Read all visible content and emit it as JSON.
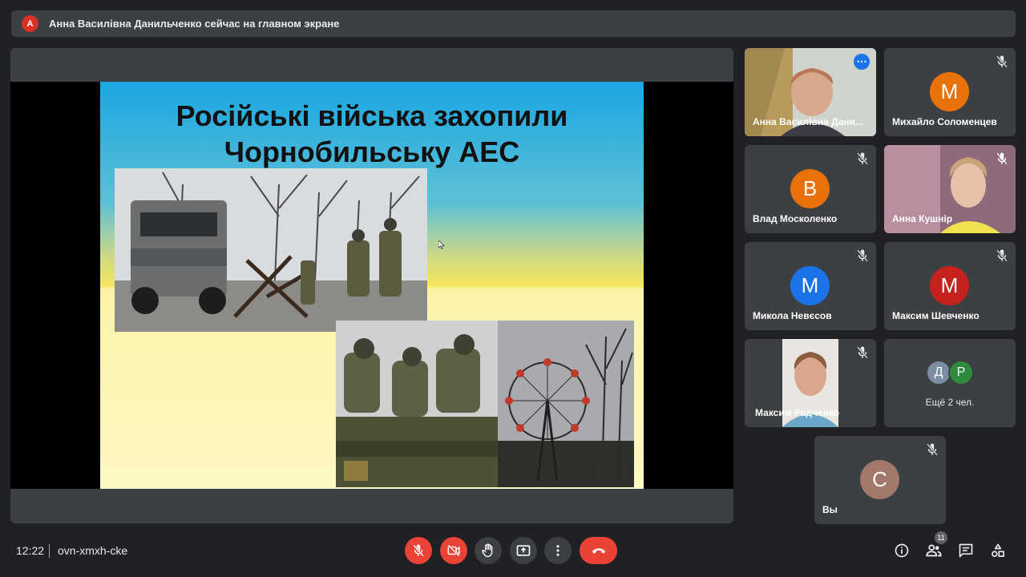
{
  "banner": {
    "avatar_letter": "А",
    "avatar_color": "#d93025",
    "text": "Анна Василівна Данильченко сейчас на главном экране"
  },
  "slide": {
    "title_line1": "Російські війська захопили",
    "title_line2": "Чорнобильську АЕС"
  },
  "participants": [
    {
      "name": "Анна Василівна Дани...",
      "type": "video",
      "active": true
    },
    {
      "name": "Михайло Соломенцев",
      "letter": "М",
      "color": "#e8710a",
      "muted": true
    },
    {
      "name": "Влад Москоленко",
      "letter": "В",
      "color": "#e8710a",
      "muted": true
    },
    {
      "name": "Анна Кушнір",
      "type": "video",
      "muted": true
    },
    {
      "name": "Микола Невєсов",
      "letter": "М",
      "color": "#1a73e8",
      "muted": true
    },
    {
      "name": "Максим Шевченко",
      "letter": "М",
      "color": "#c5221f",
      "muted": true
    },
    {
      "name": "Максим Радченко",
      "type": "video",
      "muted": true
    },
    {
      "more_label": "Ещё 2 чел.",
      "letters": [
        "Д",
        "Р"
      ],
      "colors": [
        "#7b8ea1",
        "#2e8b3e"
      ]
    },
    {
      "name": "Вы",
      "letter": "С",
      "color": "#a1786a",
      "muted": true
    }
  ],
  "bottom": {
    "time": "12:22",
    "meeting_code": "ovn-xmxh-cke",
    "participant_count": "11"
  },
  "icons": {
    "mic_off": "mic-off-icon",
    "camera_off": "camera-off-icon",
    "hand": "raise-hand-icon",
    "present": "present-icon",
    "more": "more-vert-icon",
    "end_call": "end-call-icon",
    "info": "info-icon",
    "people": "people-icon",
    "chat": "chat-icon",
    "activities": "activities-icon"
  }
}
